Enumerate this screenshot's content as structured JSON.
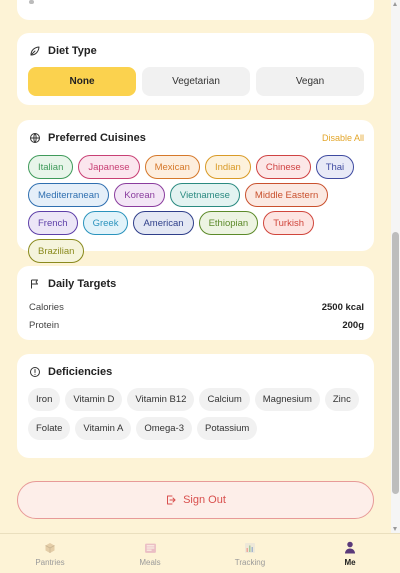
{
  "diet": {
    "title": "Diet Type",
    "options": [
      {
        "label": "None",
        "active": true
      },
      {
        "label": "Vegetarian",
        "active": false
      },
      {
        "label": "Vegan",
        "active": false
      }
    ]
  },
  "cuisines": {
    "title": "Preferred Cuisines",
    "disable_all": "Disable All",
    "items": [
      {
        "label": "Italian",
        "color": "#3f9a5a",
        "bg": "#e8f5ea"
      },
      {
        "label": "Japanese",
        "color": "#c83f74",
        "bg": "#fbe6ee"
      },
      {
        "label": "Mexican",
        "color": "#d5782a",
        "bg": "#fdeede"
      },
      {
        "label": "Indian",
        "color": "#d99a26",
        "bg": "#fdf2dc"
      },
      {
        "label": "Chinese",
        "color": "#cf4242",
        "bg": "#fce7e7"
      },
      {
        "label": "Thai",
        "color": "#3e4aa0",
        "bg": "#e8eaf7"
      },
      {
        "label": "Mediterranean",
        "color": "#2f6fb0",
        "bg": "#e5eff9"
      },
      {
        "label": "Korean",
        "color": "#8a3d9e",
        "bg": "#f3e6f6"
      },
      {
        "label": "Vietnamese",
        "color": "#2a8a80",
        "bg": "#e3f3f1"
      },
      {
        "label": "Middle Eastern",
        "color": "#c9512e",
        "bg": "#fbe9e2"
      },
      {
        "label": "French",
        "color": "#5d3fa8",
        "bg": "#ece6f7"
      },
      {
        "label": "Greek",
        "color": "#2a93bd",
        "bg": "#e2f3fa"
      },
      {
        "label": "American",
        "color": "#2f3f8a",
        "bg": "#e4e8f4"
      },
      {
        "label": "Ethiopian",
        "color": "#5c8a2a",
        "bg": "#edf4e2"
      },
      {
        "label": "Turkish",
        "color": "#d0463c",
        "bg": "#fde5e2"
      },
      {
        "label": "Brazilian",
        "color": "#8a8a1e",
        "bg": "#f5f4dc"
      }
    ]
  },
  "targets": {
    "title": "Daily Targets",
    "rows": [
      {
        "label": "Calories",
        "value": "2500 kcal"
      },
      {
        "label": "Protein",
        "value": "200g"
      }
    ]
  },
  "deficiencies": {
    "title": "Deficiencies",
    "items": [
      "Iron",
      "Vitamin D",
      "Vitamin B12",
      "Calcium",
      "Magnesium",
      "Zinc",
      "Folate",
      "Vitamin A",
      "Omega-3",
      "Potassium"
    ]
  },
  "sign_out": "Sign Out",
  "nav": [
    {
      "label": "Pantries",
      "icon": "box-icon",
      "active": false
    },
    {
      "label": "Meals",
      "icon": "meals-icon",
      "active": false
    },
    {
      "label": "Tracking",
      "icon": "chart-icon",
      "active": false
    },
    {
      "label": "Me",
      "icon": "person-icon",
      "active": true
    }
  ]
}
